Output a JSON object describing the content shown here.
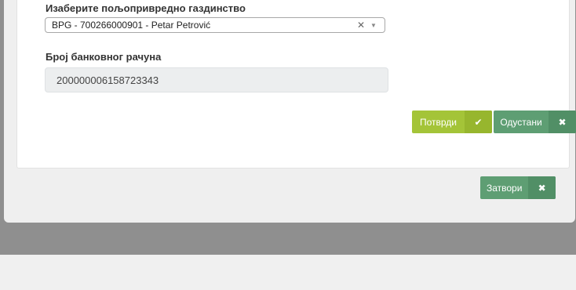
{
  "form": {
    "farm_label": "Изаберите пољопривредно газдинство",
    "farm_select_value": "BPG - 700266000901 - Petar Petrović",
    "account_label": "Број банковног рачуна",
    "account_value": "200000006158723343"
  },
  "buttons": {
    "confirm_label": "Потврди",
    "cancel_label": "Одустани",
    "close_label": "Затвори"
  },
  "icons": {
    "clear": "close-icon",
    "dropdown": "chevron-down-icon",
    "confirm": "checkmark-icon",
    "cancel": "close-icon",
    "close": "close-icon"
  },
  "colors": {
    "confirm": "#a4c438",
    "cancel": "#5e9e73",
    "close": "#5e9e73"
  }
}
